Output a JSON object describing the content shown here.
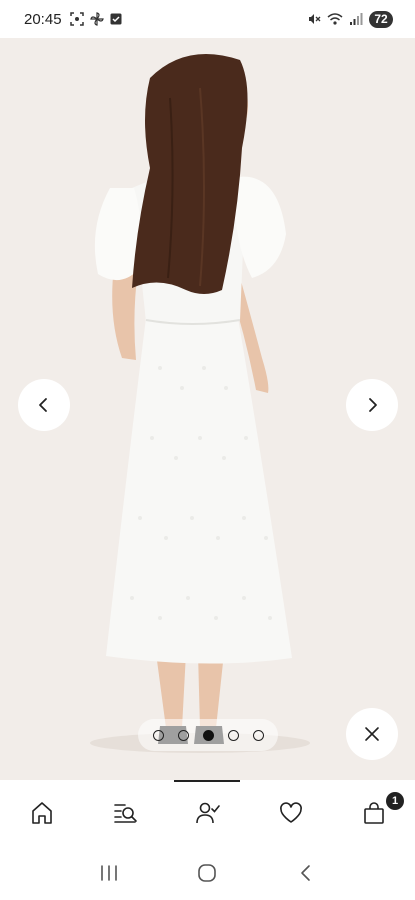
{
  "status_bar": {
    "time": "20:45",
    "battery": "72",
    "left_icons": [
      "screenshot-icon",
      "pinwheel-icon",
      "checkbox-icon"
    ],
    "right_icons": [
      "mute-icon",
      "wifi-icon",
      "signal-icon"
    ]
  },
  "gallery": {
    "image_subject": "woman-in-white-midi-dress-back-view",
    "total_images": 5,
    "active_index": 2,
    "prev_icon": "chevron-left-icon",
    "next_icon": "chevron-right-icon",
    "close_icon": "close-icon"
  },
  "tab_bar": {
    "tabs": [
      {
        "name": "home",
        "icon": "home-icon"
      },
      {
        "name": "search",
        "icon": "search-list-icon"
      },
      {
        "name": "account",
        "icon": "user-check-icon"
      },
      {
        "name": "wishlist",
        "icon": "heart-icon"
      },
      {
        "name": "bag",
        "icon": "shopping-bag-icon"
      }
    ],
    "bag_count": "1"
  },
  "system_nav": {
    "buttons": [
      "recent-apps-icon",
      "home-circle-icon",
      "back-icon"
    ]
  },
  "colors": {
    "background": "#f2ede9",
    "dress": "#f8f8f6",
    "hair": "#4a2a1c",
    "ink": "#222222"
  }
}
